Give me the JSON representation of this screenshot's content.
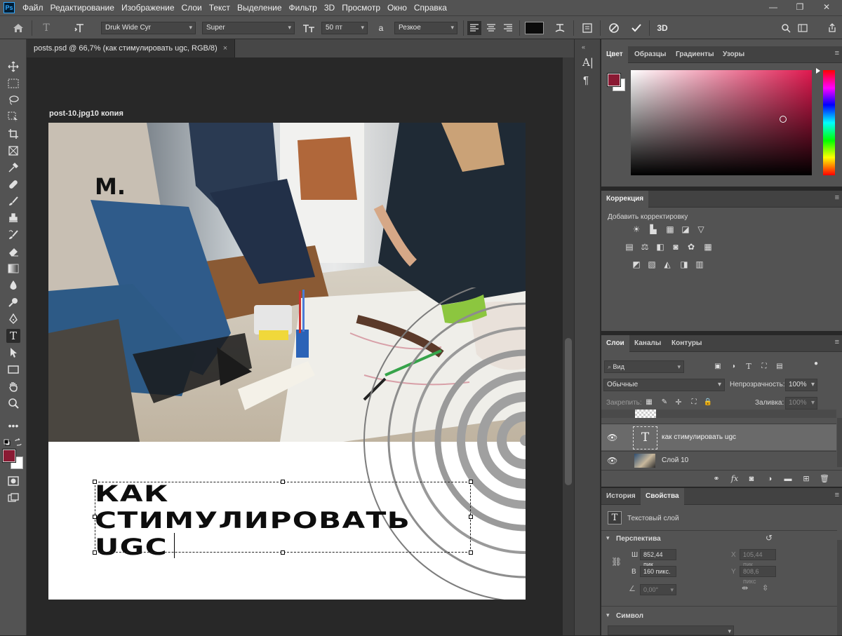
{
  "menubar": {
    "logo": "Ps",
    "items": [
      "Файл",
      "Редактирование",
      "Изображение",
      "Слои",
      "Текст",
      "Выделение",
      "Фильтр",
      "3D",
      "Просмотр",
      "Окно",
      "Справка"
    ],
    "window_buttons": [
      "—",
      "❐",
      "✕"
    ]
  },
  "options": {
    "font_family": "Druk Wide Cyr",
    "font_style": "Super",
    "font_size": "50 пт",
    "aa_label": "a",
    "antialias": "Резкое",
    "text_color": "#0b0b0b",
    "mode_3d": "3D"
  },
  "document": {
    "tab_title": "posts.psd @ 66,7% (как стимулировать ugc, RGB/8)",
    "close": "×",
    "artboard_label": "post-10.jpg10 копия",
    "logo_text": "M.",
    "headline": [
      "КАК",
      "СТИМУЛИРОВАТЬ",
      "UGC"
    ]
  },
  "colors": {
    "foreground": "#8a1a33",
    "background": "#ffffff",
    "picker_hue": "#e0194f"
  },
  "color_panel": {
    "tabs": [
      "Цвет",
      "Образцы",
      "Градиенты",
      "Узоры"
    ]
  },
  "adjust_panel": {
    "tab": "Коррекция",
    "subtitle": "Добавить корректировку"
  },
  "layers_panel": {
    "tabs": [
      "Слои",
      "Каналы",
      "Контуры"
    ],
    "search": "Вид",
    "blend_mode": "Обычные",
    "opacity_label": "Непрозрачность:",
    "opacity": "100%",
    "lock_label": "Закрепить:",
    "fill_label": "Заливка:",
    "fill": "100%",
    "layers": [
      {
        "name": "как стимулировать ugc",
        "thumb": "T"
      },
      {
        "name": "Слой 10"
      }
    ]
  },
  "props_panel": {
    "tabs": [
      "История",
      "Свойства"
    ],
    "type_label": "Текстовый слой",
    "section_transform": "Перспектива",
    "w_label": "Ш",
    "w_value": "852,44 пик",
    "h_label": "В",
    "h_value": "160 пикс.",
    "x_label": "X",
    "x_value": "105,44 пик",
    "y_label": "Y",
    "y_value": "808,6 пикс",
    "angle_value": "0,00°",
    "section_char": "Символ"
  }
}
